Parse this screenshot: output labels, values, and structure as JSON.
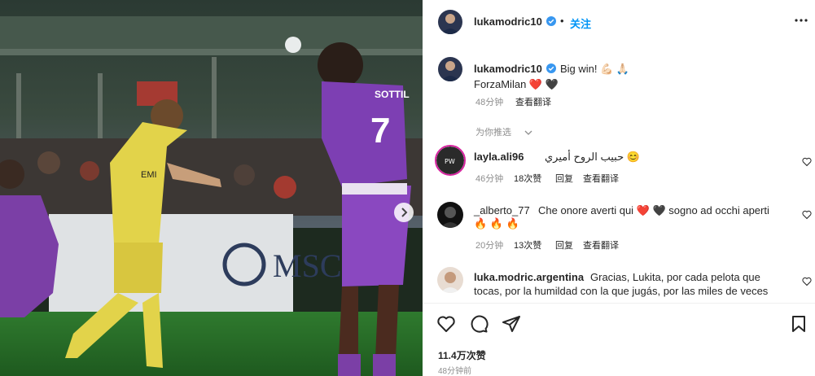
{
  "post": {
    "username": "lukamodric10",
    "follow_label": "关注",
    "caption_line1": "Big win! 💪🏻 🙏🏻",
    "caption_line2": "ForzaMilan ❤️ 🖤",
    "caption_time": "48分钟",
    "translate_label": "查看翻译",
    "recommended_label": "为你推选"
  },
  "photo": {
    "jersey_number": "7",
    "jersey_name": "SOTTIL",
    "sponsor_left": "EMI",
    "board_text": "MSC"
  },
  "comments": [
    {
      "user": "layla.ali96",
      "text": "حبيب الروح أميري 😊",
      "time": "46分钟",
      "likes": "18次赞",
      "reply": "回复",
      "translate": "查看翻译"
    },
    {
      "user": "_alberto_77",
      "text": "Che onore averti qui ❤️ 🖤 sogno ad occhi aperti",
      "text2": "🔥 🔥 🔥",
      "time": "20分钟",
      "likes": "13次赞",
      "reply": "回复",
      "translate": "查看翻译"
    },
    {
      "user": "luka.modric.argentina",
      "text": "Gracias, Lukita, por cada pelota que",
      "text2": "tocas, por la humildad con la que jugás, por las miles de veces"
    }
  ],
  "footer": {
    "likes": "11.4万次赞",
    "time": "48分钟前"
  },
  "colors": {
    "verified": "#3897f0",
    "follow": "#0095f6",
    "heart": "#ed4956"
  },
  "icons": [
    "verified-icon",
    "more-icon",
    "heart-icon",
    "comment-icon",
    "share-icon",
    "bookmark-icon",
    "chevron-down-icon",
    "next-arrow-icon"
  ]
}
